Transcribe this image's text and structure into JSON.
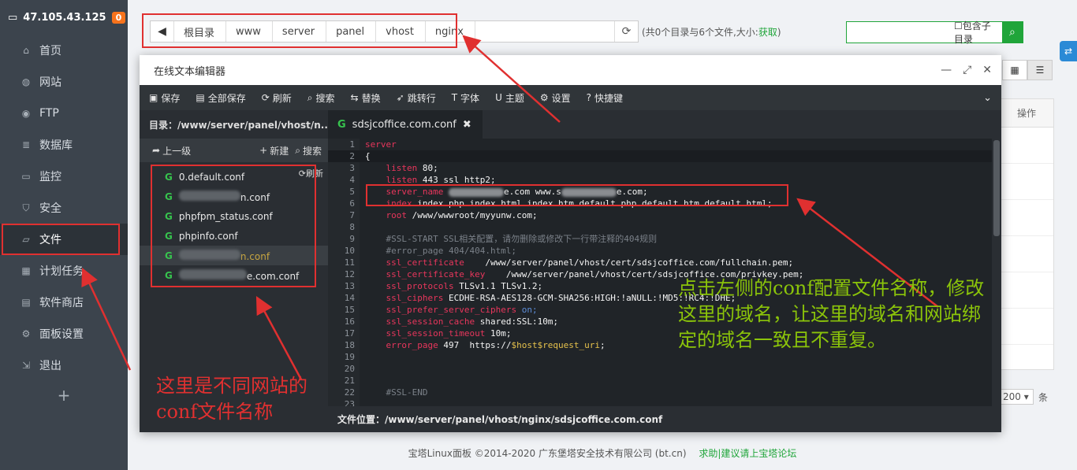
{
  "sidebar": {
    "server_ip": "47.105.43.125",
    "badge": "0",
    "items": [
      {
        "label": "首页",
        "icon": "home-icon"
      },
      {
        "label": "网站",
        "icon": "globe-icon"
      },
      {
        "label": "FTP",
        "icon": "ftp-icon"
      },
      {
        "label": "数据库",
        "icon": "database-icon"
      },
      {
        "label": "监控",
        "icon": "monitor-icon"
      },
      {
        "label": "安全",
        "icon": "shield-icon"
      },
      {
        "label": "文件",
        "icon": "folder-icon"
      },
      {
        "label": "计划任务",
        "icon": "calendar-icon"
      },
      {
        "label": "软件商店",
        "icon": "store-icon"
      },
      {
        "label": "面板设置",
        "icon": "gear-icon"
      },
      {
        "label": "退出",
        "icon": "logout-icon"
      }
    ],
    "active_index": 6,
    "add_label": "+"
  },
  "toolbar": {
    "breadcrumbs": [
      "根目录",
      "www",
      "server",
      "panel",
      "vhost",
      "nginx"
    ],
    "file_info_prefix": "(共0个目录与6个文件,大小:",
    "file_info_link": "获取",
    "file_info_suffix": ")",
    "search_placeholder": "",
    "search_subdir_label": "包含子目录"
  },
  "table": {
    "op_header": "操作"
  },
  "pager": {
    "page_size": "200",
    "unit": "条"
  },
  "footer": {
    "copyright": "宝塔Linux面板 ©2014-2020 广东堡塔安全技术有限公司 (bt.cn)",
    "help_link": "求助|建议请上宝塔论坛"
  },
  "editor": {
    "title": "在线文本编辑器",
    "toolbar": [
      {
        "label": "保存",
        "icon": "save-icon"
      },
      {
        "label": "全部保存",
        "icon": "save-all-icon"
      },
      {
        "label": "刷新",
        "icon": "refresh-icon"
      },
      {
        "label": "搜索",
        "icon": "search-icon"
      },
      {
        "label": "替换",
        "icon": "replace-icon"
      },
      {
        "label": "跳转行",
        "icon": "jump-icon"
      },
      {
        "label": "字体",
        "icon": "font-icon"
      },
      {
        "label": "主题",
        "icon": "theme-icon"
      },
      {
        "label": "设置",
        "icon": "gear-icon"
      },
      {
        "label": "快捷键",
        "icon": "help-icon"
      }
    ],
    "tree": {
      "dir_label": "目录：/www/server/panel/vhost/n...",
      "up_label": "上一级",
      "new_label": "新建",
      "search_label": "搜索",
      "refresh_label": "刷新",
      "files": [
        {
          "name": "0.default.conf",
          "redacted": false
        },
        {
          "name": "n.conf",
          "redacted": true
        },
        {
          "name": "phpfpm_status.conf",
          "redacted": false
        },
        {
          "name": "phpinfo.conf",
          "redacted": false
        },
        {
          "name": "n.conf",
          "redacted": true
        },
        {
          "name": "e.com.conf",
          "redacted": true
        }
      ],
      "selected_index": 4
    },
    "tab_name": "sdsjcoffice.com.conf",
    "status_bar": "文件位置：/www/server/panel/vhost/nginx/sdsjcoffice.com.conf",
    "code_lines": [
      "server",
      "{",
      "    listen 80;",
      "    listen 443 ssl http2;",
      "    server_name ████████e.com www.s████████e.com;",
      "    index index.php index.html index.htm default.php default.htm default.html;",
      "    root /www/wwwroot/myyunw.com;",
      "",
      "    #SSL-START SSL相关配置，请勿删除或修改下一行带注释的404规则",
      "    #error_page 404/404.html;",
      "    ssl_certificate    /www/server/panel/vhost/cert/sdsjcoffice.com/fullchain.pem;",
      "    ssl_certificate_key    /www/server/panel/vhost/cert/sdsjcoffice.com/privkey.pem;",
      "    ssl_protocols TLSv1.1 TLSv1.2;",
      "    ssl_ciphers ECDHE-RSA-AES128-GCM-SHA256:HIGH:!aNULL:!MD5:!RC4:!DHE;",
      "    ssl_prefer_server_ciphers on;",
      "    ssl_session_cache shared:SSL:10m;",
      "    ssl_session_timeout 10m;",
      "    error_page 497  https://$host$request_uri;",
      "",
      "",
      "",
      "    #SSL-END",
      ""
    ]
  },
  "annotations": {
    "left_note": "这里是不同网站的conf文件名称",
    "right_note": "点击左侧的conf配置文件名称，修改这里的域名，让这里的域名和网站绑定的域名一致且不重复。"
  },
  "colors": {
    "accent_green": "#20a53a",
    "sidebar_bg": "#3c444d",
    "annotation_red": "#e03030",
    "annotation_green": "#8bc40a"
  }
}
